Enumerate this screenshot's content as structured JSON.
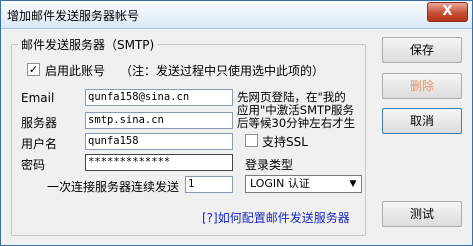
{
  "window": {
    "title": "增加邮件发送服务器帐号",
    "close_label": "X"
  },
  "group": {
    "legend": "邮件发送服务器（SMTP)"
  },
  "enable": {
    "checked": "✓",
    "label": "启用此账号",
    "note": "（注：发送过程中只使用选中此项的）"
  },
  "fields": {
    "email_label": "Email",
    "email_value": "qunfa158@sina.cn",
    "server_label": "服务器",
    "server_value": "smtp.sina.cn",
    "username_label": "用户名",
    "username_value": "qunfa158",
    "password_label": "密码",
    "password_value": "*************",
    "consecutive_label": "一次连接服务器连续发送",
    "consecutive_value": "1"
  },
  "hint": {
    "line1": "先网页登陆，在\"我的",
    "line2": "应用\"中激活SMTP服务",
    "line3": "后等候30分钟左右才生"
  },
  "ssl": {
    "checked": "",
    "label": "支持SSL"
  },
  "login_type": {
    "label": "登录类型",
    "selected": "LOGIN 认证",
    "arrow": "▼"
  },
  "help_link": "[?]如何配置邮件发送服务器",
  "buttons": {
    "save": "保存",
    "delete": "删除",
    "cancel": "取消",
    "test": "测试"
  }
}
